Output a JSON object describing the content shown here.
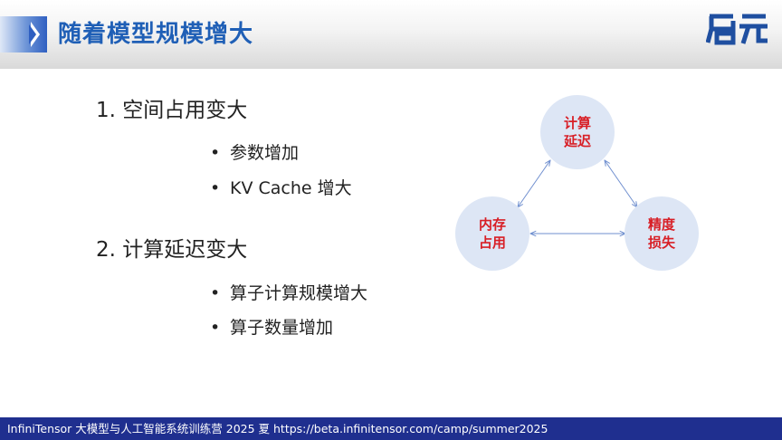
{
  "slide": {
    "title": "随着模型规模增大",
    "logo_text": "启元",
    "points": [
      {
        "heading": "1. 空间占用变大",
        "bullets": [
          "参数增加",
          "KV Cache 增大"
        ]
      },
      {
        "heading": "2. 计算延迟变大",
        "bullets": [
          "算子计算规模增大",
          "算子数量增加"
        ]
      }
    ],
    "bullet_symbol": "•"
  },
  "diagram": {
    "top_node": [
      "计算",
      "延迟"
    ],
    "left_node": [
      "内存",
      "占用"
    ],
    "right_node": [
      "精度",
      "损失"
    ]
  },
  "footer": {
    "left_text": "InfiniTensor 大模型与人工智能系统训练营 2025 夏",
    "url": "https://beta.infinitensor.com/camp/summer2025"
  },
  "colors": {
    "title": "#1f5fb6",
    "node_text": "#d81f26",
    "node_fill": "#dde6f5",
    "arrow": "#6f8fcf",
    "footer_bg": "#1f2f8f",
    "logo": "#1f4fa0"
  }
}
